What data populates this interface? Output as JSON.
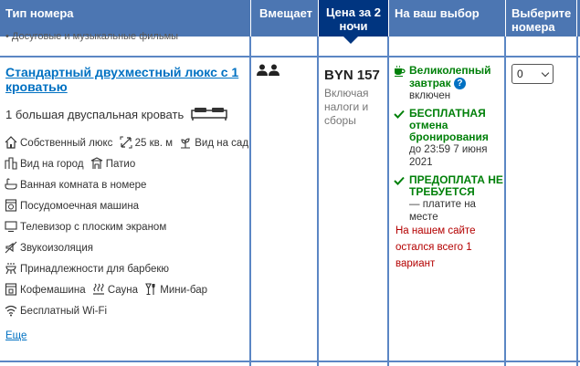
{
  "header": {
    "room_type": "Тип номера",
    "sleeps": "Вмещает",
    "price": "Цена за 2 ночи",
    "your_choice": "На ваш выбор",
    "select_rooms": "Выберите номера"
  },
  "previous_row": {
    "cut_text": "• Досуговые и музыкальные фильмы"
  },
  "room": {
    "title": "Стандартный двухместный люкс с 1 кроватью",
    "bed": "1 большая двуспальная кровать",
    "facilities": [
      {
        "label": "Собственный люкс",
        "icon": "house-icon"
      },
      {
        "label": "25 кв. м",
        "icon": "area-icon"
      },
      {
        "label": "Вид на сад",
        "icon": "garden-icon"
      },
      {
        "label": "Вид на город",
        "icon": "city-icon"
      },
      {
        "label": "Патио",
        "icon": "patio-icon"
      },
      {
        "label": "Ванная комната в номере",
        "icon": "bath-icon"
      },
      {
        "label": "Посудомоечная машина",
        "icon": "dishwasher-icon"
      },
      {
        "label": "Телевизор с плоским экраном",
        "icon": "tv-icon"
      },
      {
        "label": "Звукоизоляция",
        "icon": "soundproof-icon"
      },
      {
        "label": "Принадлежности для барбекю",
        "icon": "bbq-icon"
      },
      {
        "label": "Кофемашина",
        "icon": "coffee-machine-icon"
      },
      {
        "label": "Сауна",
        "icon": "sauna-icon"
      },
      {
        "label": "Мини-бар",
        "icon": "minibar-icon"
      },
      {
        "label": "Бесплатный Wi-Fi",
        "icon": "wifi-icon"
      }
    ],
    "more_link": "Еще",
    "price": "BYN 157",
    "price_note": "Включая налоги и сборы"
  },
  "options": {
    "breakfast_title": "Великолепный завтрак",
    "breakfast_sub": "включен",
    "cancel_title": "БЕСПЛАТНАЯ отмена бронирования",
    "cancel_sub": "до 23:59 7 июня 2021",
    "prepay_title": "ПРЕДОПЛАТА НЕ ТРЕБУЕТСЯ",
    "prepay_sub": "— платите на месте",
    "scarcity": "На нашем сайте остался всего 1 вариант"
  },
  "select": {
    "value": "0"
  },
  "colors": {
    "header_bg": "#4c76b2",
    "price_header_bg": "#003580",
    "link": "#0071c2",
    "green": "#008009",
    "scarcity_red": "#b40000"
  }
}
